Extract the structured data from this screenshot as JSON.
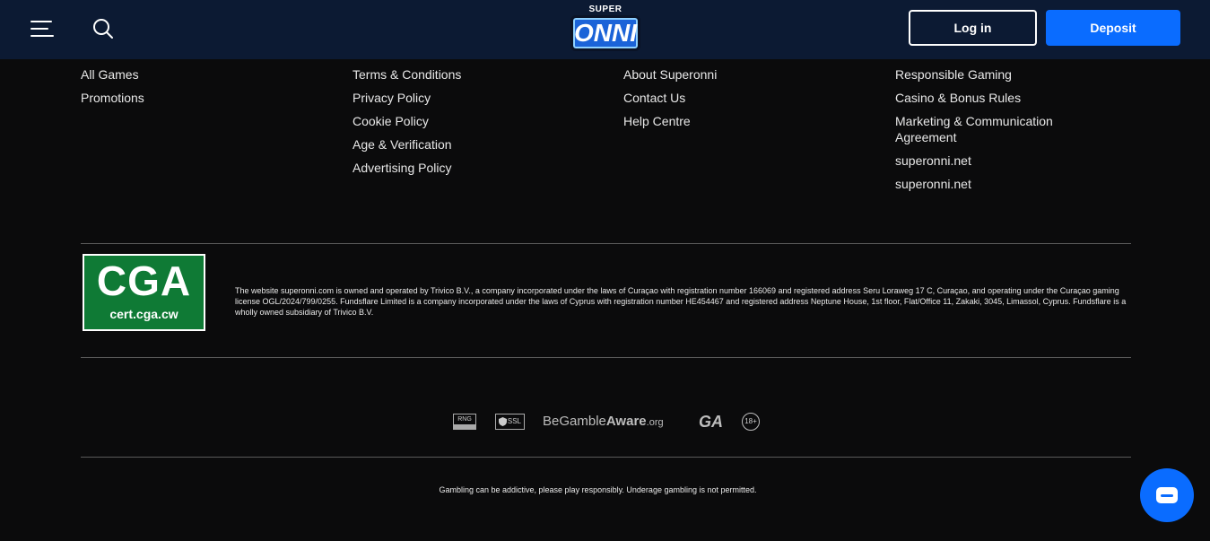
{
  "header": {
    "logo_top": "SUPER",
    "logo_main": "ONNI",
    "login_label": "Log in",
    "deposit_label": "Deposit"
  },
  "footer_links": {
    "col1": [
      "All Games",
      "Promotions"
    ],
    "col2": [
      "Terms & Conditions",
      "Privacy Policy",
      "Cookie Policy",
      "Age & Verification",
      "Advertising Policy"
    ],
    "col3": [
      "About Superonni",
      "Contact Us",
      "Help Centre"
    ],
    "col4": [
      "Marketing & Communication Agreement",
      "superonni.net",
      "superonni.net"
    ],
    "col4_top": [
      "Responsible Gaming",
      "Casino & Bonus Rules"
    ]
  },
  "license": {
    "cga_big": "CGA",
    "cga_small": "cert.cga.cw",
    "text": "The website superonni.com is owned and operated by Trivico B.V., a company incorporated under the laws of Curaçao with registration number 166069 and registered address Seru Loraweg 17 C, Curaçao, and operating under the Curaçao gaming license OGL/2024/799/0255. Fundsflare Limited is a company incorporated under the laws of Cyprus with registration number HE454467 and registered address Neptune House, 1st floor, Flat/Office 11, Zakaki, 3045, Limassol, Cyprus. Fundsflare is a wholly owned subsidiary of Trivico B.V."
  },
  "badges": {
    "rng": "RNG",
    "ssl": "SSL",
    "bga_1": "BeGamble",
    "bga_2": "Aware",
    "bga_3": ".org",
    "ga": "GA",
    "age": "18+"
  },
  "warning": "Gambling can be addictive, please play responsibly. Underage gambling is not permitted.",
  "colors": {
    "header_bg": "#0c1a33",
    "page_bg": "#0b0b0c",
    "accent": "#0a6cff",
    "cga_green": "#0f7a35"
  }
}
